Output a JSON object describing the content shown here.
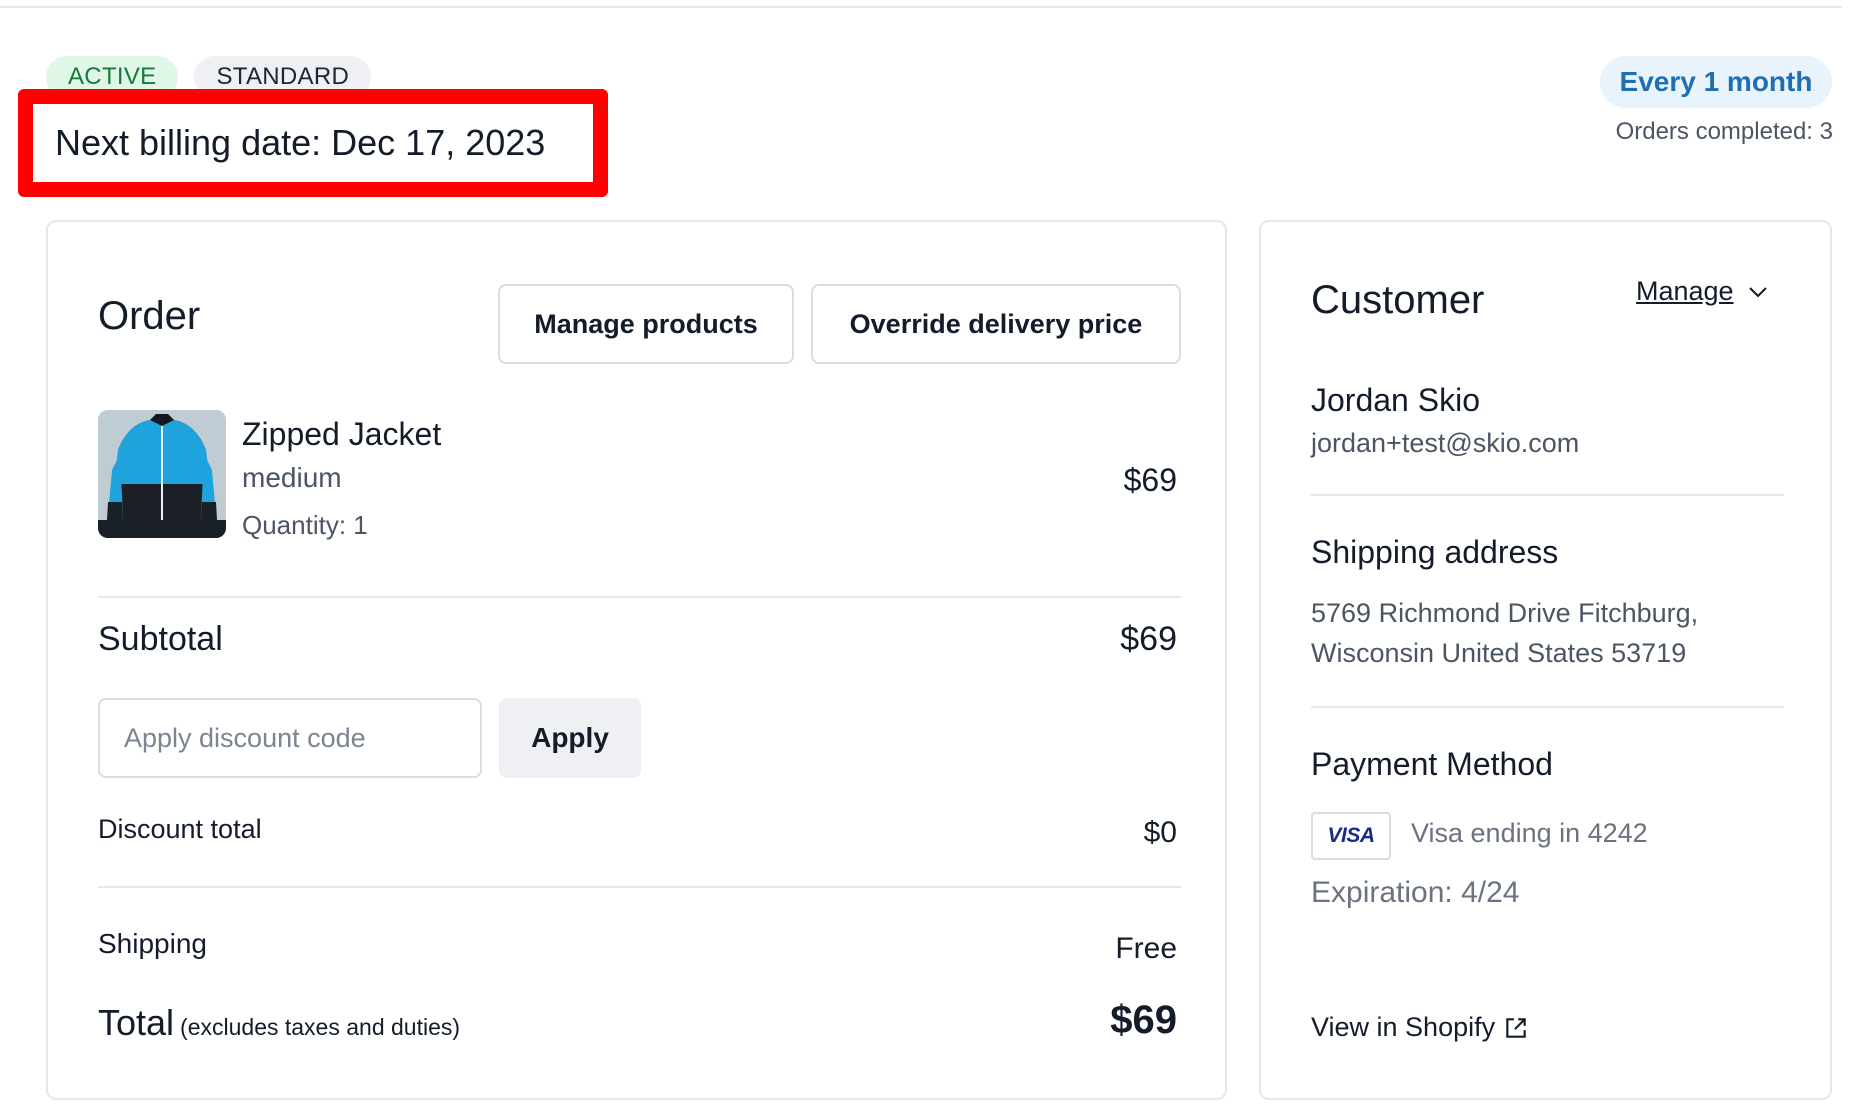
{
  "header": {
    "status_badge": "ACTIVE",
    "plan_badge": "STANDARD",
    "next_billing": "Next billing date: Dec 17, 2023",
    "frequency": "Every 1 month",
    "orders_completed": "Orders completed: 3",
    "highlight_color": "#ff0000"
  },
  "order": {
    "title": "Order",
    "manage_products_label": "Manage products",
    "override_delivery_label": "Override delivery price",
    "product": {
      "name": "Zipped Jacket",
      "variant": "medium",
      "quantity": "Quantity: 1",
      "price": "$69",
      "image_icon": "jacket-photo"
    },
    "subtotal_label": "Subtotal",
    "subtotal_value": "$69",
    "discount_placeholder": "Apply discount code",
    "apply_label": "Apply",
    "discount_total_label": "Discount total",
    "discount_total_value": "$0",
    "shipping_label": "Shipping",
    "shipping_value": "Free",
    "total_label": "Total",
    "total_note": "(excludes taxes and duties)",
    "total_value": "$69"
  },
  "customer": {
    "title": "Customer",
    "manage_label": "Manage",
    "name": "Jordan Skio",
    "email": "jordan+test@skio.com",
    "shipping_title": "Shipping address",
    "address_line1": "5769 Richmond Drive Fitchburg,",
    "address_line2": "Wisconsin United States 53719",
    "payment_title": "Payment Method",
    "card_brand": "VISA",
    "card_text": "Visa ending in 4242",
    "expiration": "Expiration: 4/24",
    "shopify_label": "View in Shopify"
  },
  "colors": {
    "active_badge_bg": "#dff7e6",
    "active_badge_text": "#177a3c",
    "frequency_bg": "#e8f3fc",
    "frequency_text": "#1f6fb0"
  }
}
